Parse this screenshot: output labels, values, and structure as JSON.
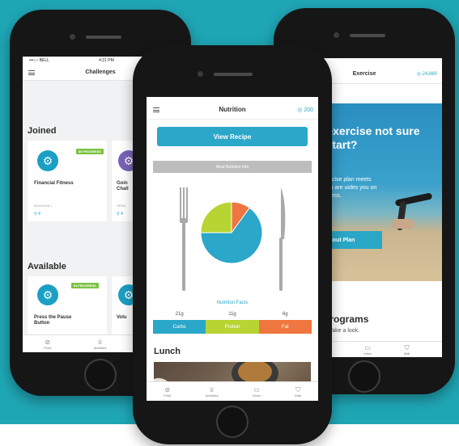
{
  "colors": {
    "background": "#1fa6b5",
    "accent": "#2aa7c9",
    "in_progress": "#7cc242",
    "carbs": "#2aa7c9",
    "protein": "#b8d433",
    "fat": "#f0763f",
    "gear_blue": "#1b9fc4",
    "gear_purple": "#7a63b8"
  },
  "left_phone": {
    "status": {
      "carrier": "•••○○ BELL",
      "time": "4:21 PM"
    },
    "title": "Challenges",
    "joined_heading": "Joined",
    "joined_cards": [
      {
        "badge": "IN PROGRESS",
        "title": "Financial Fitness",
        "meta": "BOOLEAN •",
        "count": "4"
      },
      {
        "title": "Goin Chall",
        "meta": "SPEN",
        "count": "4"
      }
    ],
    "available_heading": "Available",
    "available_cards": [
      {
        "badge": "IN PROGRESS",
        "title": "Press the Pause Button"
      },
      {
        "title": "Volu"
      }
    ],
    "tabs": [
      "Feed",
      "Activities",
      "Inbox"
    ]
  },
  "center_phone": {
    "title": "Nutrition",
    "points": "200",
    "view_recipe": "View Recipe",
    "meal_info": "Meal Nutrition Info",
    "nutrition_facts": "Nutrition Facts",
    "pie": [
      {
        "name": "Carbs",
        "value": 65
      },
      {
        "name": "Protein",
        "value": 25
      },
      {
        "name": "Fat",
        "value": 10
      }
    ],
    "macros": [
      {
        "amount": "21g",
        "label": "Carbs"
      },
      {
        "amount": "11g",
        "label": "Protein"
      },
      {
        "amount": "6g",
        "label": "Fat"
      }
    ],
    "lunch_heading": "Lunch",
    "tabs": [
      "Feed",
      "Activities",
      "Inbox",
      "Mall"
    ]
  },
  "right_phone": {
    "title": "Exercise",
    "points": "24,860",
    "hero_title": "dy to exercise not sure where tart?",
    "hero_sub": "a custom exercise plan meets you where you are uides you on a path to r fitness.",
    "hero_button": "ld Your Workout Plan",
    "programs_heading": "Fitness Programs",
    "programs_sub": "something new? Take a look.",
    "tabs": [
      "Activities",
      "Inbox",
      "Mall"
    ]
  }
}
